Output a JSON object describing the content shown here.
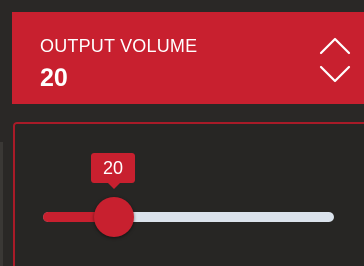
{
  "colors": {
    "accent": "#c8202f",
    "background": "#2a2826",
    "track": "#dbe3ec",
    "text": "#ffffff"
  },
  "output_volume": {
    "title": "OUTPUT VOLUME",
    "value": "20",
    "increment_icon": "chevron-up-icon",
    "decrement_icon": "chevron-down-icon"
  },
  "slider": {
    "value": 20,
    "value_label": "20",
    "min": 0,
    "max": 100
  }
}
